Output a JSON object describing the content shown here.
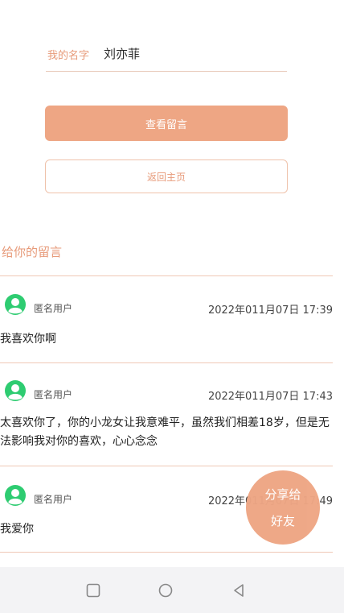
{
  "form": {
    "name_label": "我的名字",
    "name_value": "刘亦菲"
  },
  "buttons": {
    "view_messages": "查看留言",
    "back_home": "返回主页"
  },
  "section": {
    "title": "给你的留言"
  },
  "messages": [
    {
      "user": "匿名用户",
      "time": "2022年011月07日 17:39",
      "content": "我喜欢你啊"
    },
    {
      "user": "匿名用户",
      "time": "2022年011月07日 17:43",
      "content": "太喜欢你了，你的小龙女让我意难平，虽然我们相差18岁，但是无法影响我对你的喜欢，心心念念"
    },
    {
      "user": "匿名用户",
      "time": "2022年011月07日 17:49",
      "content": "我爱你"
    }
  ],
  "share": {
    "line1": "分享给",
    "line2": "好友"
  },
  "colors": {
    "accent": "#eea684",
    "avatar": "#2ecc71",
    "divider": "#efc8b6"
  },
  "icons": {
    "avatar": "user-avatar-icon",
    "nav_square": "square-icon",
    "nav_home": "circle-icon",
    "nav_back": "triangle-back-icon"
  }
}
